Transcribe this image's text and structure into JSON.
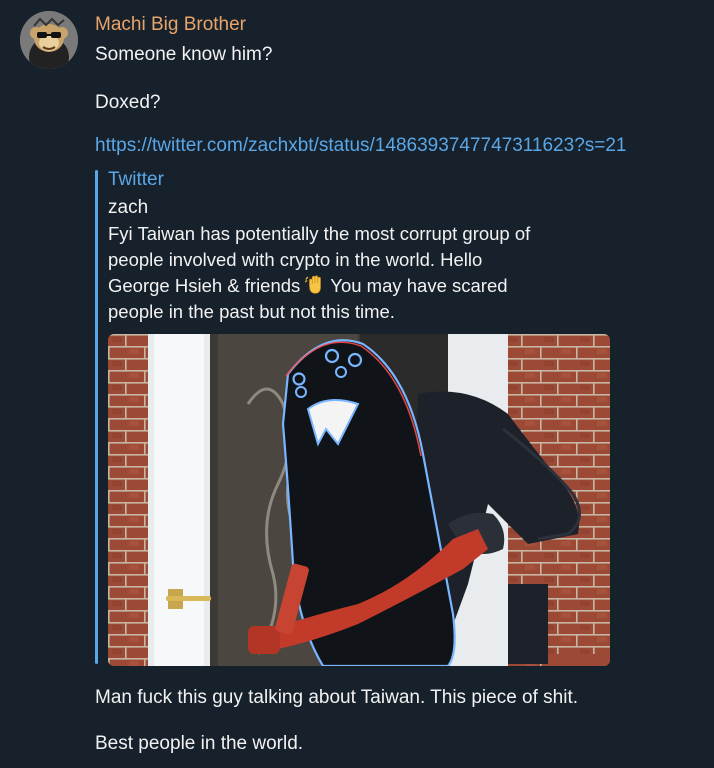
{
  "sender": {
    "name": "Machi Big Brother",
    "avatar_icon": "cartoon-ape-avatar-icon",
    "name_color": "#e9a469"
  },
  "messages": [
    "Someone know him?",
    "Doxed?",
    "Man fuck this guy talking about Taiwan. This piece of shit.",
    "Best people in the world."
  ],
  "link": {
    "url": "https://twitter.com/zachxbt/status/1486393747747311623?s=21",
    "color": "#5aa7e8"
  },
  "preview": {
    "site": "Twitter",
    "author": "zach",
    "text_lines": [
      "Fyi Taiwan has potentially the most corrupt group of",
      "people involved with crypto in the world. Hello",
      "George Hsieh & friends",
      "You may have scared",
      "people in the past but not this time."
    ],
    "emoji_icon": "waving-hand-icon",
    "image_icon": "penguin-burglar-ram-image"
  },
  "colors": {
    "background": "#17212b",
    "text": "#f2f2f2",
    "accent": "#5aa7e8"
  }
}
